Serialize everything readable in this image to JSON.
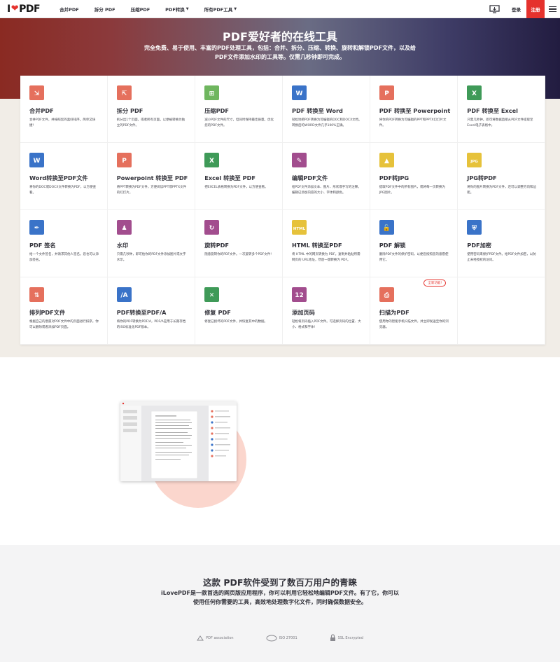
{
  "nav": {
    "logo_prefix": "I",
    "logo_suffix": "PDF",
    "menu": [
      "合并PDF",
      "拆分 PDF",
      "压缩PDF",
      "PDF转换",
      "所有PDF工具"
    ],
    "login": "登录",
    "signup": "注册"
  },
  "hero": {
    "title": "PDF爱好者的在线工具",
    "subtitle": "完全免费、易于使用、丰富的PDF处理工具，包括：合并、拆分、压缩、转换、旋转和解锁PDF文件，以及给PDF文件添加水印的工具等。仅需几秒钟即可完成。"
  },
  "colors": {
    "brand": "#e5322d",
    "hero_left": "#8a2a22",
    "hero_right": "#221c40",
    "beige": "#f1ede7"
  },
  "tools": [
    {
      "title": "合并PDF",
      "desc": "合并PDF文件，并按照您的喜好排序。简单又快捷!",
      "icon": "merge-icon",
      "color": "#e5705d"
    },
    {
      "title": "拆分 PDF",
      "desc": "拆分出1个页面，或者所有页面，以便被转换为独立的PDF文件。",
      "icon": "split-icon",
      "color": "#e5705d"
    },
    {
      "title": "压缩PDF",
      "desc": "减小PDF文件的尺寸，但同时保持最佳质量。优化您的PDF文件。",
      "icon": "compress-icon",
      "color": "#6fb65f"
    },
    {
      "title": "PDF 转换至 Word",
      "desc": "轻松地把PDF转换为可编辑的DOC和DOCX文档。转换后的WORD文件几乎100%正确。",
      "icon": "word-icon",
      "color": "#3a73c8"
    },
    {
      "title": "PDF 转换至 Powerpoint",
      "desc": "将你的PDF转换为可编辑的PPT和PPTX幻灯片文件。",
      "icon": "powerpoint-icon",
      "color": "#e5705d"
    },
    {
      "title": "PDF 转换至 Excel",
      "desc": "只需几秒钟，即可将数据直接从PDF文件提取至Excel电子表格中。",
      "icon": "excel-icon",
      "color": "#3f9a58"
    },
    {
      "title": "Word转换至PDF文件",
      "desc": "将你的DOC或DOCX文件转换为PDF，以方便查看。",
      "icon": "word-to-pdf-icon",
      "color": "#3a73c8"
    },
    {
      "title": "Powerpoint 转换至 PDF",
      "desc": "将PPT转换为PDF文件，方便阅读PPT或PPTX文件的幻灯片。",
      "icon": "ppt-to-pdf-icon",
      "color": "#e5705d"
    },
    {
      "title": "Excel 转换至 PDF",
      "desc": "把EXCEL表格转换为PDF文件，以方便查看。",
      "icon": "excel-to-pdf-icon",
      "color": "#3f9a58"
    },
    {
      "title": "编辑PDF文件",
      "desc": "给PDF文件添加文本、图片、形状或手写的注释。编辑已添加内容的大小、字体和颜色。",
      "icon": "edit-icon",
      "color": "#a24d8e"
    },
    {
      "title": "PDF转JPG",
      "desc": "提取PDF文件中的所有图片，或将每一页转换为JPG图片。",
      "icon": "pdf-to-jpg-icon",
      "color": "#e6c23b"
    },
    {
      "title": "JPG转PDF",
      "desc": "将你的图片转换为PDF文件，还可以调整方向和边距。",
      "icon": "jpg-to-pdf-icon",
      "color": "#e6c23b"
    },
    {
      "title": "PDF 签名",
      "desc": "给一个文件签名，并请求其他人签名。您也可以添加签名。",
      "icon": "sign-icon",
      "color": "#3a73c8"
    },
    {
      "title": "水印",
      "desc": "只需几秒钟，即可给你的PDF文件添加图片或文字水印。",
      "icon": "watermark-icon",
      "color": "#a24d8e"
    },
    {
      "title": "旋转PDF",
      "desc": "随意旋转你的PDF文件。一次旋转多个PDF文件!",
      "icon": "rotate-icon",
      "color": "#a24d8e"
    },
    {
      "title": "HTML 转换至PDF",
      "desc": "将 HTML 中的网页转换为 PDF。复制并粘贴所需网页的 URL地址，然后一键转换为 PDF。",
      "icon": "html-icon",
      "color": "#e6c23b"
    },
    {
      "title": "PDF 解锁",
      "desc": "删除PDF文件的保护密码，以便您按照您的意愿使用它。",
      "icon": "unlock-icon",
      "color": "#3a73c8"
    },
    {
      "title": "PDF加密",
      "desc": "使用密码来保护PDF文件。给PDF文件加密，以防止未经授权的访问。",
      "icon": "protect-icon",
      "color": "#3a73c8"
    },
    {
      "title": "排列PDF文件",
      "desc": "根据自己的意愿对PDF文件中的页面进行排序。你可以删除或者添加PDF页面。",
      "icon": "organize-icon",
      "color": "#e5705d"
    },
    {
      "title": "PDF转换至PDF/A",
      "desc": "将你的PDF转换为PDF/A，PDF/A是用于长期存档的ISO标准化PDF版本。",
      "icon": "pdfa-icon",
      "color": "#3a73c8"
    },
    {
      "title": "修复 PDF",
      "desc": "修复已损坏的PDF文件，并恢复其中的数据。",
      "icon": "repair-icon",
      "color": "#3f9a58"
    },
    {
      "title": "添加页码",
      "desc": "轻松将页码插入PDF文件。可选择页码的位置、大小、格式和字体!",
      "icon": "page-numbers-icon",
      "color": "#a24d8e"
    },
    {
      "title": "扫描为PDF",
      "desc": "使用你的智能手机扫描文件，并立即发送至你的浏览器。",
      "icon": "scan-icon",
      "color": "#e5705d",
      "badge": "全新功能!"
    }
  ],
  "bottom": {
    "title": "这款 PDF软件受到了数百万用户的青睐",
    "text": "iLovePDF是一款首选的网页版应用程序，你可以利用它轻松地编辑PDF文件。有了它，你可以使用任何你需要的工具，高效地处理数字化文件，同时确保数据安全。",
    "trust": [
      {
        "icon": "pdf-association-icon",
        "label": "PDF association"
      },
      {
        "icon": "iso-icon",
        "label": "ISO 27001"
      },
      {
        "icon": "ssl-lock-icon",
        "label": "SSL Encrypted"
      }
    ]
  }
}
